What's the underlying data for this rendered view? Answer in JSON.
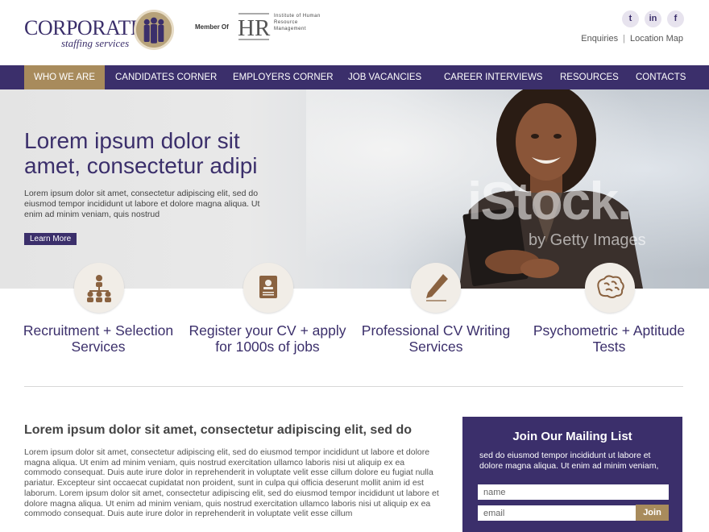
{
  "brand": {
    "name": "CORPORATE",
    "tagline": "staffing services",
    "member_of": "Member Of",
    "hr_logo": "HR",
    "hr_org": "Institute of Human Resource Management"
  },
  "social": [
    "twitter-icon",
    "linkedin-icon",
    "facebook-icon"
  ],
  "social_glyphs": {
    "twitter": "t",
    "linkedin": "in",
    "facebook": "f"
  },
  "top_links": {
    "enquiries": "Enquiries",
    "location": "Location Map"
  },
  "nav": [
    "WHO WE ARE",
    "CANDIDATES CORNER",
    "EMPLOYERS CORNER",
    "JOB VACANCIES",
    "CAREER INTERVIEWS",
    "RESOURCES",
    "CONTACTS"
  ],
  "hero": {
    "title": "Lorem ipsum dolor sit amet, consectetur adipi",
    "text": "Lorem ipsum dolor sit amet, consectetur adipiscing elit, sed do eiusmod tempor incididunt ut labore et dolore magna aliqua. Ut enim ad minim veniam, quis nostrud",
    "button": "Learn More",
    "watermark": "iStock.",
    "watermark_sub": "by Getty Images"
  },
  "services": [
    {
      "label": "Recruitment + Selection Services",
      "icon": "people-hierarchy-icon"
    },
    {
      "label": "Register your CV + apply for 1000s of jobs",
      "icon": "cv-document-icon"
    },
    {
      "label": "Professional CV Writing Services",
      "icon": "pen-writing-icon"
    },
    {
      "label": "Psychometric + Aptitude Tests",
      "icon": "brain-icon"
    }
  ],
  "content": {
    "heading": "Lorem ipsum dolor sit amet, consectetur adipiscing elit, sed do",
    "body": "Lorem ipsum dolor sit amet, consectetur adipiscing elit, sed do eiusmod tempor incididunt ut labore et dolore magna aliqua. Ut enim ad minim veniam, quis nostrud exercitation ullamco laboris nisi ut aliquip ex ea commodo consequat. Duis aute irure dolor in reprehenderit in voluptate velit esse cillum dolore eu fugiat nulla pariatur. Excepteur sint occaecat cupidatat non proident, sunt in culpa qui officia deserunt mollit anim id est laborum. Lorem ipsum dolor sit amet, consectetur adipiscing elit, sed do eiusmod tempor incididunt ut labore et dolore magna aliqua. Ut enim ad minim veniam, quis nostrud exercitation ullamco laboris nisi ut aliquip ex ea commodo consequat. Duis aute irure dolor in reprehenderit in voluptate velit esse cillum"
  },
  "mailing": {
    "title": "Join Our Mailing List",
    "text": "sed do eiusmod tempor incididunt ut labore et dolore magna aliqua. Ut enim ad minim veniam,",
    "name_placeholder": "name",
    "email_placeholder": "email",
    "join": "Join"
  },
  "colors": {
    "primary": "#3b2f6b",
    "accent": "#a88b5c",
    "icon_bg": "#f1ede7"
  }
}
